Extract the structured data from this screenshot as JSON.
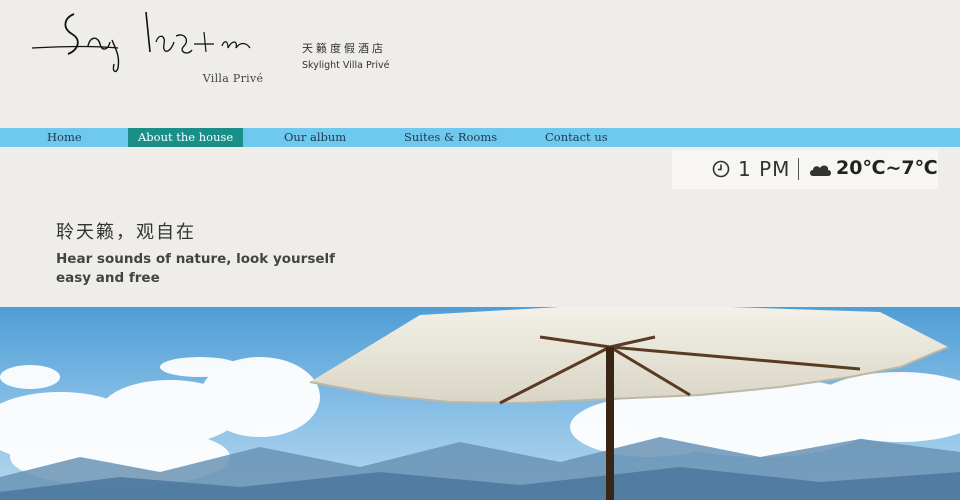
{
  "logo": {
    "subtitle": "Villa Privé"
  },
  "hotel": {
    "name_cn": "天籁度假酒店",
    "name_en": "Skylight Villa Privé"
  },
  "nav": {
    "items": [
      {
        "label": "Home",
        "active": false
      },
      {
        "label": "About the house",
        "active": true
      },
      {
        "label": "Our album",
        "active": false
      },
      {
        "label": "Suites & Rooms",
        "active": false
      },
      {
        "label": "Contact us",
        "active": false
      }
    ],
    "bar_color": "#6fc8ee",
    "active_color": "#1a8f8a"
  },
  "weather": {
    "time": "1 PM",
    "temperature": "20℃~7℃",
    "time_icon": "clock-icon",
    "weather_icon": "cloud-icon"
  },
  "tagline": {
    "cn": "聆天籁，观自在",
    "en_line1": "Hear sounds of nature, look yourself",
    "en_line2": "easy and free"
  }
}
